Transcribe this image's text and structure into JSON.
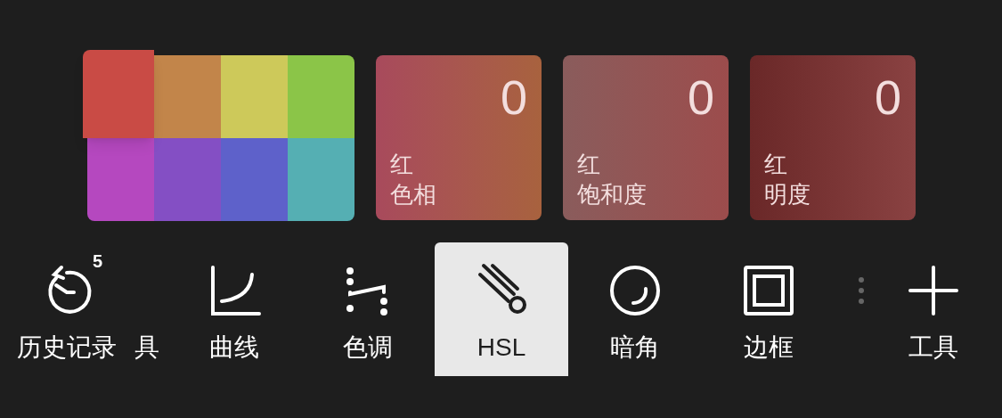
{
  "swatches": [
    {
      "color": "#c94b45",
      "selected": true
    },
    {
      "color": "#c2854a",
      "selected": false
    },
    {
      "color": "#cdc95a",
      "selected": false
    },
    {
      "color": "#8bc548",
      "selected": false
    },
    {
      "color": "#b548bf",
      "selected": false
    },
    {
      "color": "#844fc4",
      "selected": false
    },
    {
      "color": "#5e61ca",
      "selected": false
    },
    {
      "color": "#55afb3",
      "selected": false
    }
  ],
  "adjustments": [
    {
      "kind": "hue",
      "value": "0",
      "color_name": "红",
      "label": "色相"
    },
    {
      "kind": "saturation",
      "value": "0",
      "color_name": "红",
      "label": "饱和度"
    },
    {
      "kind": "lightness",
      "value": "0",
      "color_name": "红",
      "label": "明度"
    }
  ],
  "toolbar": [
    {
      "kind": "history",
      "label": "历史记录",
      "badge": "5",
      "trailing": "具",
      "selected": false
    },
    {
      "kind": "curve",
      "label": "曲线",
      "selected": false
    },
    {
      "kind": "tone",
      "label": "色调",
      "selected": false
    },
    {
      "kind": "hsl",
      "label": "HSL",
      "selected": true
    },
    {
      "kind": "vignette",
      "label": "暗角",
      "selected": false
    },
    {
      "kind": "frame",
      "label": "边框",
      "selected": false
    },
    {
      "kind": "ghost",
      "selected": false
    },
    {
      "kind": "tools",
      "label": "工具",
      "selected": false
    }
  ]
}
